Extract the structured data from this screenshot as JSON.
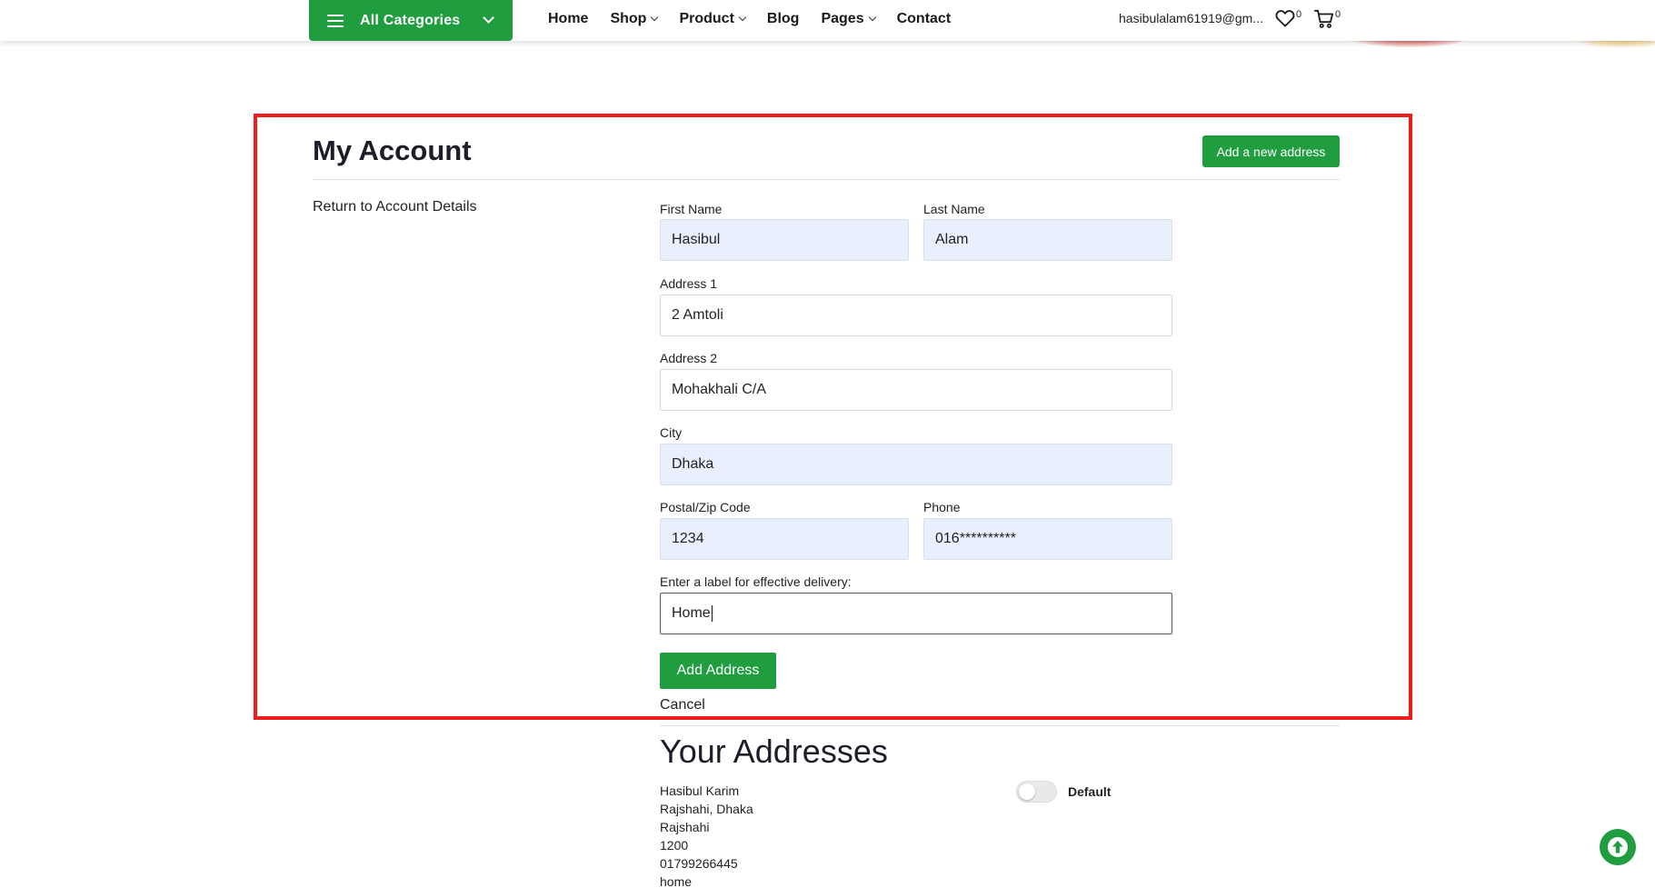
{
  "header": {
    "all_categories": "All Categories",
    "nav": [
      {
        "label": "Home",
        "dropdown": false
      },
      {
        "label": "Shop",
        "dropdown": true
      },
      {
        "label": "Product",
        "dropdown": true
      },
      {
        "label": "Blog",
        "dropdown": false
      },
      {
        "label": "Pages",
        "dropdown": true
      },
      {
        "label": "Contact",
        "dropdown": false
      }
    ],
    "user_email": "hasibulalam61919@gm...",
    "wishlist_count": "0",
    "cart_count": "0"
  },
  "account": {
    "title": "My Account",
    "add_new_address_label": "Add a new address",
    "return_link": "Return to Account Details"
  },
  "form": {
    "first_name": {
      "label": "First Name",
      "value": "Hasibul"
    },
    "last_name": {
      "label": "Last Name",
      "value": "Alam"
    },
    "address1": {
      "label": "Address 1",
      "value": "2 Amtoli"
    },
    "address2": {
      "label": "Address 2",
      "value": "Mohakhali C/A"
    },
    "city": {
      "label": "City",
      "value": "Dhaka"
    },
    "postal": {
      "label": "Postal/Zip Code",
      "value": "1234"
    },
    "phone": {
      "label": "Phone",
      "value": "016**********"
    },
    "delivery_label": {
      "label": "Enter a label for effective delivery:",
      "value": "Home"
    },
    "submit_label": "Add Address",
    "cancel_label": "Cancel"
  },
  "addresses": {
    "title": "Your Addresses",
    "items": [
      {
        "lines": [
          "Hasibul Karim",
          "Rajshahi, Dhaka",
          "Rajshahi",
          "1200",
          "01799266445",
          "home"
        ],
        "default_label": "Default",
        "is_default": false
      }
    ]
  },
  "colors": {
    "brand_green": "#1f9d3f",
    "highlight_red": "#ee1c1c",
    "autofill_blue": "#e8f0fe"
  },
  "icons": [
    "menu-icon",
    "chevron-down-icon",
    "heart-icon",
    "cart-icon",
    "arrow-up-icon"
  ]
}
